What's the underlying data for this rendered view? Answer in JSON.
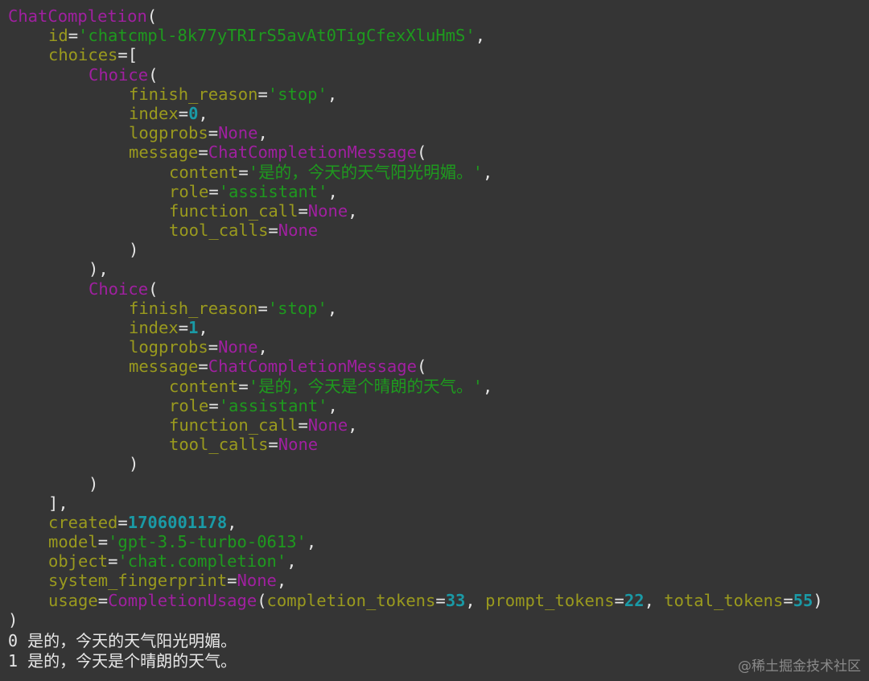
{
  "colors": {
    "background": "#353535",
    "class_name": "#a020a0",
    "keyword": "#9a9a1e",
    "string": "#1e9a1e",
    "number": "#1a9aa6",
    "punctuation": "#e6e6e6"
  },
  "repr": {
    "class_name": "ChatCompletion",
    "id_key": "id",
    "id_value": "'chatcmpl-8k77yTRIrS5avAt0TigCfexXluHmS'",
    "choices_key": "choices",
    "choice_class": "Choice",
    "finish_reason_key": "finish_reason",
    "finish_reason_value": "'stop'",
    "index_key": "index",
    "logprobs_key": "logprobs",
    "message_key": "message",
    "message_class": "ChatCompletionMessage",
    "content_key": "content",
    "role_key": "role",
    "role_value": "'assistant'",
    "function_call_key": "function_call",
    "tool_calls_key": "tool_calls",
    "none_value": "None",
    "choices": [
      {
        "index": "0",
        "content": "'是的，今天的天气阳光明媚。'"
      },
      {
        "index": "1",
        "content": "'是的，今天是个晴朗的天气。'"
      }
    ],
    "created_key": "created",
    "created_value": "1706001178",
    "model_key": "model",
    "model_value": "'gpt-3.5-turbo-0613'",
    "object_key": "object",
    "object_value": "'chat.completion'",
    "system_fingerprint_key": "system_fingerprint",
    "usage_key": "usage",
    "usage_class": "CompletionUsage",
    "completion_tokens_key": "completion_tokens",
    "completion_tokens_value": "33",
    "prompt_tokens_key": "prompt_tokens",
    "prompt_tokens_value": "22",
    "total_tokens_key": "total_tokens",
    "total_tokens_value": "55"
  },
  "output_lines": [
    "0 是的，今天的天气阳光明媚。",
    "1 是的，今天是个晴朗的天气。"
  ],
  "watermark": "@稀土掘金技术社区"
}
